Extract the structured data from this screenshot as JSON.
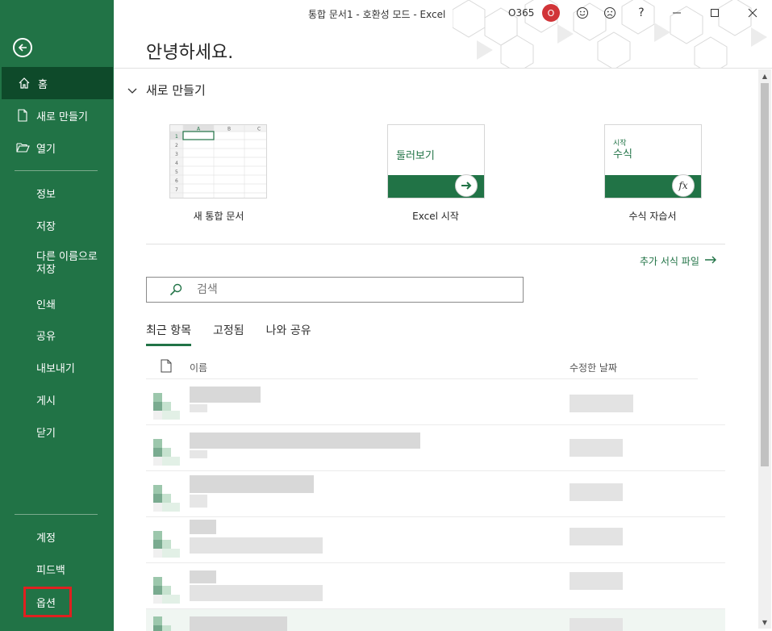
{
  "window": {
    "title": "통합 문서1  -  호환성 모드  -  Excel",
    "account": "O365",
    "avatar_initial": "O",
    "accent_color": "#217346"
  },
  "sidebar": {
    "top_items": [
      {
        "label": "홈",
        "icon": "home-icon",
        "active": true
      },
      {
        "label": "새로 만들기",
        "icon": "new-document-icon"
      },
      {
        "label": "열기",
        "icon": "folder-open-icon"
      }
    ],
    "mid_items": [
      {
        "label": "정보"
      },
      {
        "label": "저장"
      },
      {
        "label": "다른 이름으로 저장"
      },
      {
        "label": "인쇄"
      },
      {
        "label": "공유"
      },
      {
        "label": "내보내기"
      },
      {
        "label": "게시"
      },
      {
        "label": "닫기"
      }
    ],
    "bottom_items": [
      {
        "label": "계정"
      },
      {
        "label": "피드백"
      },
      {
        "label": "옵션",
        "highlighted": true
      }
    ]
  },
  "main": {
    "greeting": "안녕하세요.",
    "new_section": {
      "title": "새로 만들기",
      "templates": [
        {
          "label": "새 통합 문서"
        },
        {
          "label": "Excel 시작",
          "tile_text": "둘러보기"
        },
        {
          "label": "수식 자습서",
          "tile_small": "시작",
          "tile_text": "수식",
          "tile_icon": "fx"
        }
      ],
      "more_link": "추가 서식 파일"
    },
    "search": {
      "placeholder": "검색"
    },
    "tabs": [
      {
        "label": "최근 항목",
        "active": true
      },
      {
        "label": "고정됨"
      },
      {
        "label": "나와 공유"
      }
    ],
    "list": {
      "col_name": "이름",
      "col_date": "수정한 날짜"
    },
    "sheet_preview": {
      "cols": [
        "A",
        "B",
        "C"
      ],
      "rows": [
        "1",
        "2",
        "3",
        "4",
        "5",
        "6",
        "7"
      ]
    }
  }
}
